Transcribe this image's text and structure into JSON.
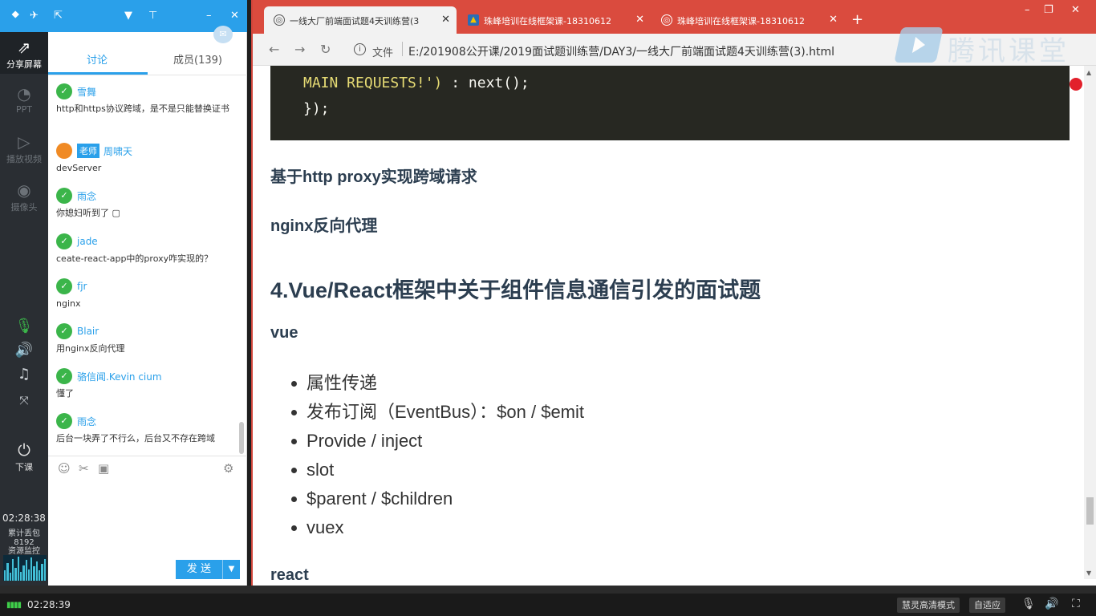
{
  "rail": {
    "share_screen": "分享屏幕",
    "ppt": "PPT",
    "play_video": "播放视频",
    "camera": "摄像头",
    "end_class": "下课",
    "clock": "02:28:38",
    "packet_loss_label": "累计丢包",
    "packet_loss_value": "8192",
    "resource_monitor": "资源监控"
  },
  "chat": {
    "tab_discussion": "讨论",
    "tab_members": "成员(139)",
    "messages": [
      {
        "name": "雪舞",
        "text": "http和https协议跨域，是不是只能替换证书"
      },
      {
        "name": "周啸天",
        "teacher": "老师",
        "text": "devServer"
      },
      {
        "name": "雨念",
        "text": "你媳妇听到了 ▢"
      },
      {
        "name": "jade",
        "text": "ceate-react-app中的proxy咋实现的？"
      },
      {
        "name": "fjr",
        "text": "nginx"
      },
      {
        "name": "Blair",
        "text": "用nginx反向代理"
      },
      {
        "name": "骆信闻.Kevin cium",
        "text": "懂了"
      },
      {
        "name": "雨念",
        "text": "后台一块弄了不行么，后台又不存在跨域"
      }
    ],
    "send_label": "发 送"
  },
  "browser": {
    "tabs": [
      {
        "title": "一线大厂前端面试题4天训练营(3"
      },
      {
        "title": "珠峰培训在线框架课-18310612"
      },
      {
        "title": "珠峰培训在线框架课-18310612"
      }
    ],
    "file_label": "文件",
    "url": "E:/201908公开课/2019面试题训练营/DAY3/一线大厂前端面试题4天训练营(3).html",
    "watermark": "腾讯课堂"
  },
  "page": {
    "code_line1_string": "MAIN REQUESTS!')",
    "code_line1_rest": " : next();",
    "code_line2": "});",
    "heading_proxy": "基于http proxy实现跨域请求",
    "heading_nginx": "nginx反向代理",
    "heading_section4": "4.Vue/React框架中关于组件信息通信引发的面试题",
    "heading_vue": "vue",
    "vue_items": [
      "属性传递",
      "发布订阅（EventBus）：$on / $emit",
      "Provide / inject",
      "slot",
      "$parent / $children",
      "vuex"
    ],
    "heading_react": "react"
  },
  "status": {
    "time": "02:28:39",
    "mode": "慧灵高清模式",
    "adapt": "自适应"
  },
  "colors": {
    "brand_blue": "#2aa0ea",
    "chrome_red": "#da4b3e",
    "wechat_green": "#3bb54a",
    "heading": "#2c3e50"
  }
}
